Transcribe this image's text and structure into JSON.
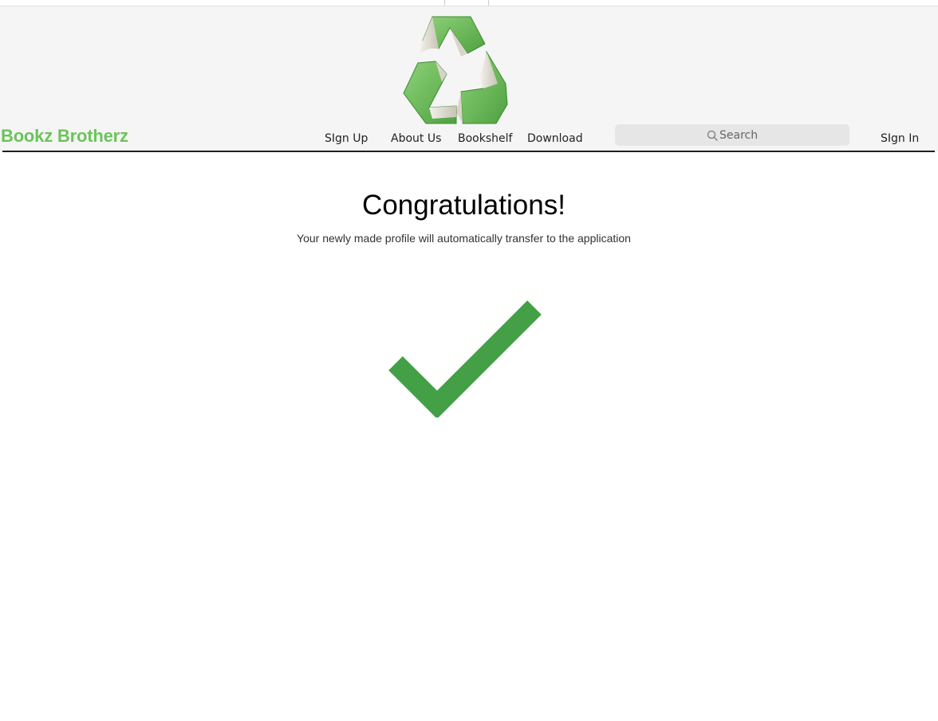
{
  "brand": {
    "name": "Bookz Brotherz",
    "color": "#6cc35c"
  },
  "nav": {
    "sign_up": "SIgn Up",
    "about_us": "About Us",
    "bookshelf": "Bookshelf",
    "download": "Download",
    "sign_in": "SIgn In"
  },
  "search": {
    "placeholder": "Search",
    "icon": "search-icon"
  },
  "logo": {
    "icon": "recycle-books-logo"
  },
  "main": {
    "title": "Congratulations!",
    "message": "Your newly made profile will automatically transfer to the application",
    "success_icon": "checkmark-icon",
    "success_color": "#43a047"
  }
}
